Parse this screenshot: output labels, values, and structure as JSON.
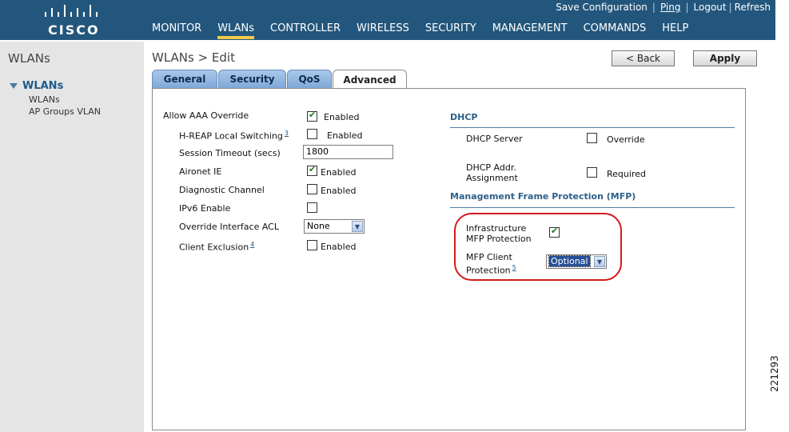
{
  "header": {
    "logo_text": "CISCO",
    "utility_links": [
      "Save Configuration",
      "Ping",
      "Logout",
      "Refresh"
    ],
    "nav": [
      "MONITOR",
      "WLANs",
      "CONTROLLER",
      "WIRELESS",
      "SECURITY",
      "MANAGEMENT",
      "COMMANDS",
      "HELP"
    ],
    "active_nav": "WLANs"
  },
  "sidebar": {
    "title": "WLANs",
    "section": "WLANs",
    "items": [
      "WLANs",
      "AP Groups VLAN"
    ]
  },
  "main": {
    "title": "WLANs > Edit",
    "back_label": "< Back",
    "apply_label": "Apply",
    "tabs": [
      "General",
      "Security",
      "QoS",
      "Advanced"
    ],
    "active_tab": "Advanced"
  },
  "left_fields": {
    "allow_aaa_override": {
      "label": "Allow AAA Override",
      "checked": true,
      "text": "Enabled"
    },
    "hreap_local_switching": {
      "label": "H-REAP Local Switching",
      "footnote": "3",
      "checked": false,
      "text": "Enabled"
    },
    "session_timeout": {
      "label": "Session Timeout (secs)",
      "value": "1800"
    },
    "aironet_ie": {
      "label": "Aironet IE",
      "checked": true,
      "text": "Enabled"
    },
    "diagnostic_channel": {
      "label": "Diagnostic Channel",
      "checked": false,
      "text": "Enabled"
    },
    "ipv6_enable": {
      "label": "IPv6 Enable",
      "checked": false
    },
    "override_interface_acl": {
      "label": "Override Interface ACL",
      "value": "None"
    },
    "client_exclusion": {
      "label": "Client Exclusion",
      "footnote": "4",
      "checked": false,
      "text": "Enabled"
    }
  },
  "dhcp": {
    "heading": "DHCP",
    "server": {
      "label": "DHCP Server",
      "checked": false,
      "text": "Override"
    },
    "addr_assignment": {
      "label_line1": "DHCP Addr.",
      "label_line2": "Assignment",
      "checked": false,
      "text": "Required"
    }
  },
  "mfp": {
    "heading": "Management Frame Protection (MFP)",
    "infrastructure": {
      "label_line1": "Infrastructure",
      "label_line2": "MFP Protection",
      "checked": true
    },
    "client_protection": {
      "label_line1": "MFP Client",
      "label_line2": "Protection",
      "footnote": "5",
      "value": "Optional"
    },
    "highlight_color": "#d41a1a"
  },
  "figure_code": "221293",
  "colors": {
    "header_bg": "#23567c",
    "nav_active_underline": "#f2c94c",
    "sidebar_bg": "#e5e5e5",
    "section_text": "#2e5f8a"
  }
}
